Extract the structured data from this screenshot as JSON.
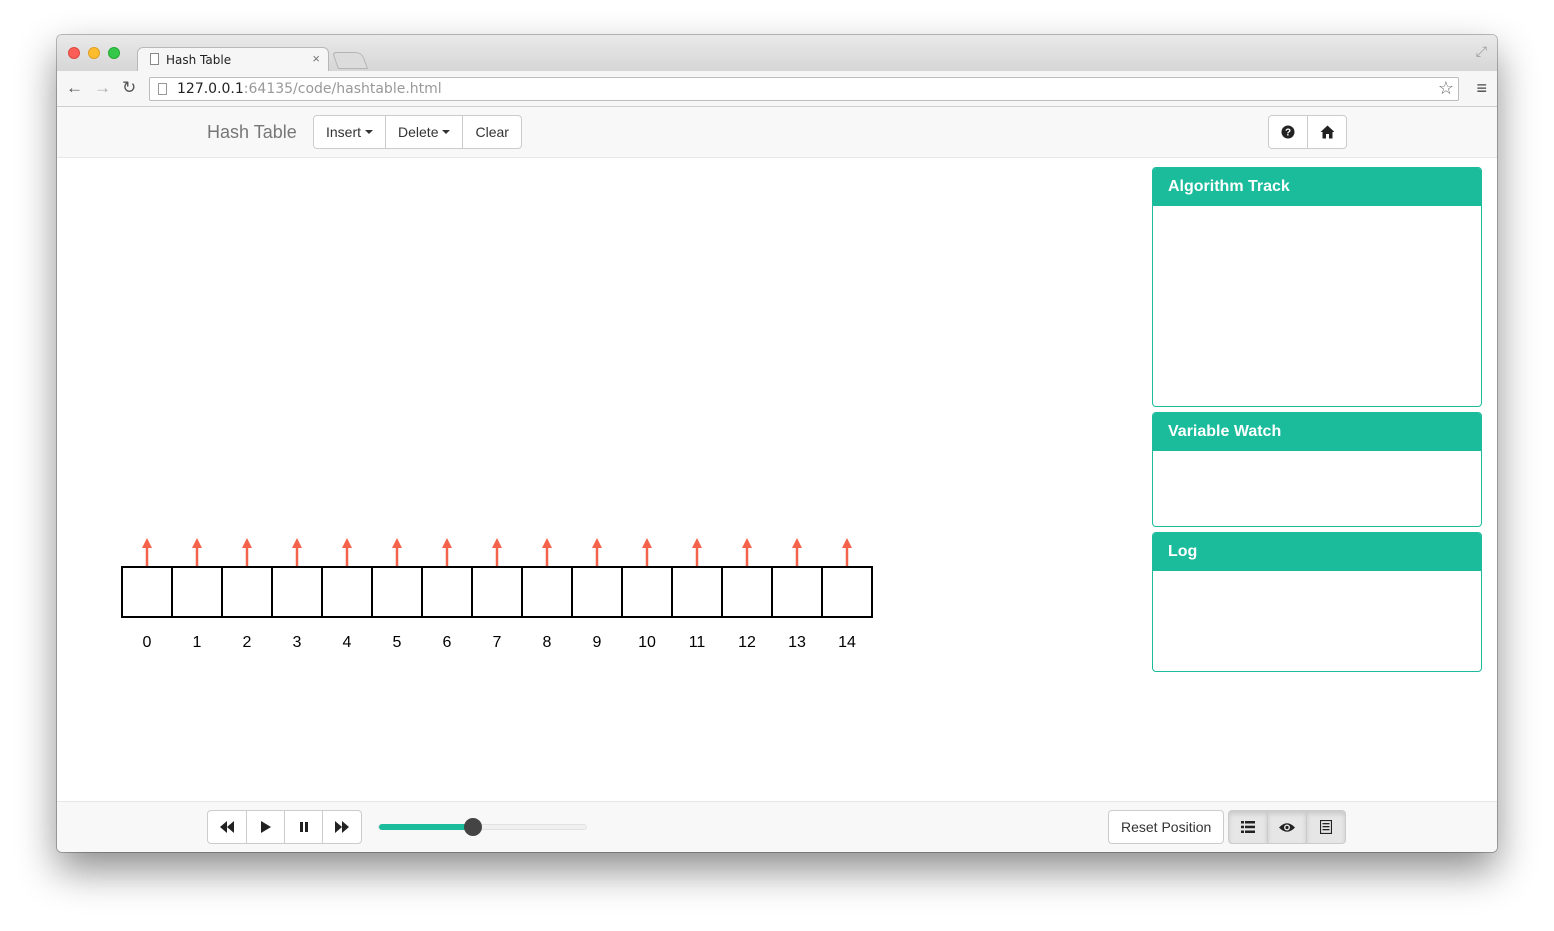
{
  "browser": {
    "tab_title": "Hash Table",
    "tab_close": "×",
    "url_host": "127.0.0.1",
    "url_rest": ":64135/code/hashtable.html"
  },
  "navbar": {
    "brand": "Hash Table",
    "insert_label": "Insert",
    "delete_label": "Delete",
    "clear_label": "Clear"
  },
  "hashtable": {
    "indices": [
      "0",
      "1",
      "2",
      "3",
      "4",
      "5",
      "6",
      "7",
      "8",
      "9",
      "10",
      "11",
      "12",
      "13",
      "14"
    ],
    "cells": [
      "",
      "",
      "",
      "",
      "",
      "",
      "",
      "",
      "",
      "",
      "",
      "",
      "",
      "",
      ""
    ],
    "arrow_color": "#f4644a"
  },
  "panels": {
    "algorithm_track": {
      "title": "Algorithm Track"
    },
    "variable_watch": {
      "title": "Variable Watch"
    },
    "log": {
      "title": "Log"
    }
  },
  "footer": {
    "speed_fraction": 0.45,
    "reset_label": "Reset Position"
  },
  "colors": {
    "accent": "#1abc9c",
    "arrow": "#f4644a"
  }
}
